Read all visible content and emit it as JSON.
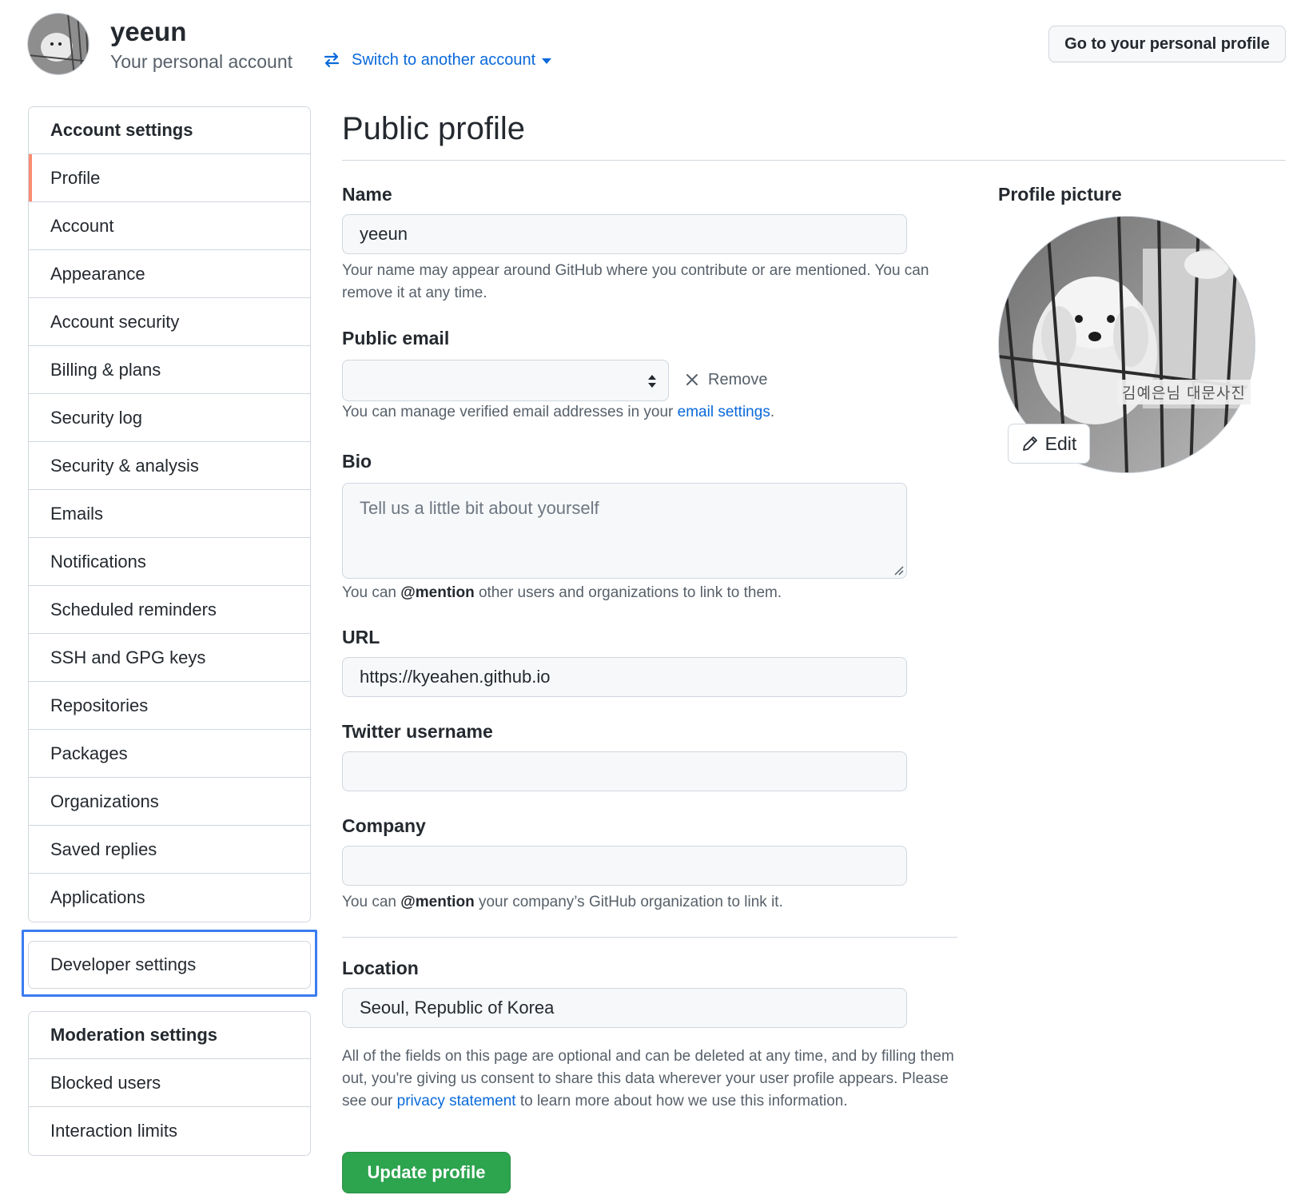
{
  "header": {
    "username": "yeeun",
    "subtitle": "Your personal account",
    "switch_label": "Switch to another account",
    "personal_profile_button": "Go to your personal profile"
  },
  "sidebar": {
    "account_heading": "Account settings",
    "items": [
      {
        "label": "Profile",
        "selected": true
      },
      {
        "label": "Account"
      },
      {
        "label": "Appearance"
      },
      {
        "label": "Account security"
      },
      {
        "label": "Billing & plans"
      },
      {
        "label": "Security log"
      },
      {
        "label": "Security & analysis"
      },
      {
        "label": "Emails"
      },
      {
        "label": "Notifications"
      },
      {
        "label": "Scheduled reminders"
      },
      {
        "label": "SSH and GPG keys"
      },
      {
        "label": "Repositories"
      },
      {
        "label": "Packages"
      },
      {
        "label": "Organizations"
      },
      {
        "label": "Saved replies"
      },
      {
        "label": "Applications"
      }
    ],
    "developer_settings": "Developer settings",
    "moderation_heading": "Moderation settings",
    "moderation_items": [
      {
        "label": "Blocked users"
      },
      {
        "label": "Interaction limits"
      }
    ]
  },
  "main": {
    "title": "Public profile",
    "name": {
      "label": "Name",
      "value": "yeeun",
      "note": "Your name may appear around GitHub where you contribute or are mentioned. You can remove it at any time."
    },
    "public_email": {
      "label": "Public email",
      "value": "",
      "remove_label": "Remove",
      "note_prefix": "You can manage verified email addresses in your ",
      "note_link": "email settings",
      "note_suffix": "."
    },
    "bio": {
      "label": "Bio",
      "placeholder": "Tell us a little bit about yourself",
      "note_prefix": "You can ",
      "note_bold": "@mention",
      "note_suffix": " other users and organizations to link to them."
    },
    "url": {
      "label": "URL",
      "value": "https://kyeahen.github.io"
    },
    "twitter": {
      "label": "Twitter username",
      "value": ""
    },
    "company": {
      "label": "Company",
      "value": "",
      "note_prefix": "You can ",
      "note_bold": "@mention",
      "note_suffix": " your company’s GitHub organization to link it."
    },
    "location": {
      "label": "Location",
      "value": "Seoul, Republic of Korea"
    },
    "consent": {
      "prefix": "All of the fields on this page are optional and can be deleted at any time, and by filling them out, you're giving us consent to share this data wherever your user profile appears. Please see our ",
      "link": "privacy statement",
      "suffix": " to learn more about how we use this information."
    },
    "update_button": "Update profile"
  },
  "profile_picture": {
    "label": "Profile picture",
    "caption": "김예은님 대문사진",
    "edit_label": "Edit"
  },
  "colors": {
    "accent_link": "#0969da",
    "selected_indicator": "#fd8c73",
    "primary_button": "#2da44e",
    "highlight_box": "#3b7cf0"
  }
}
